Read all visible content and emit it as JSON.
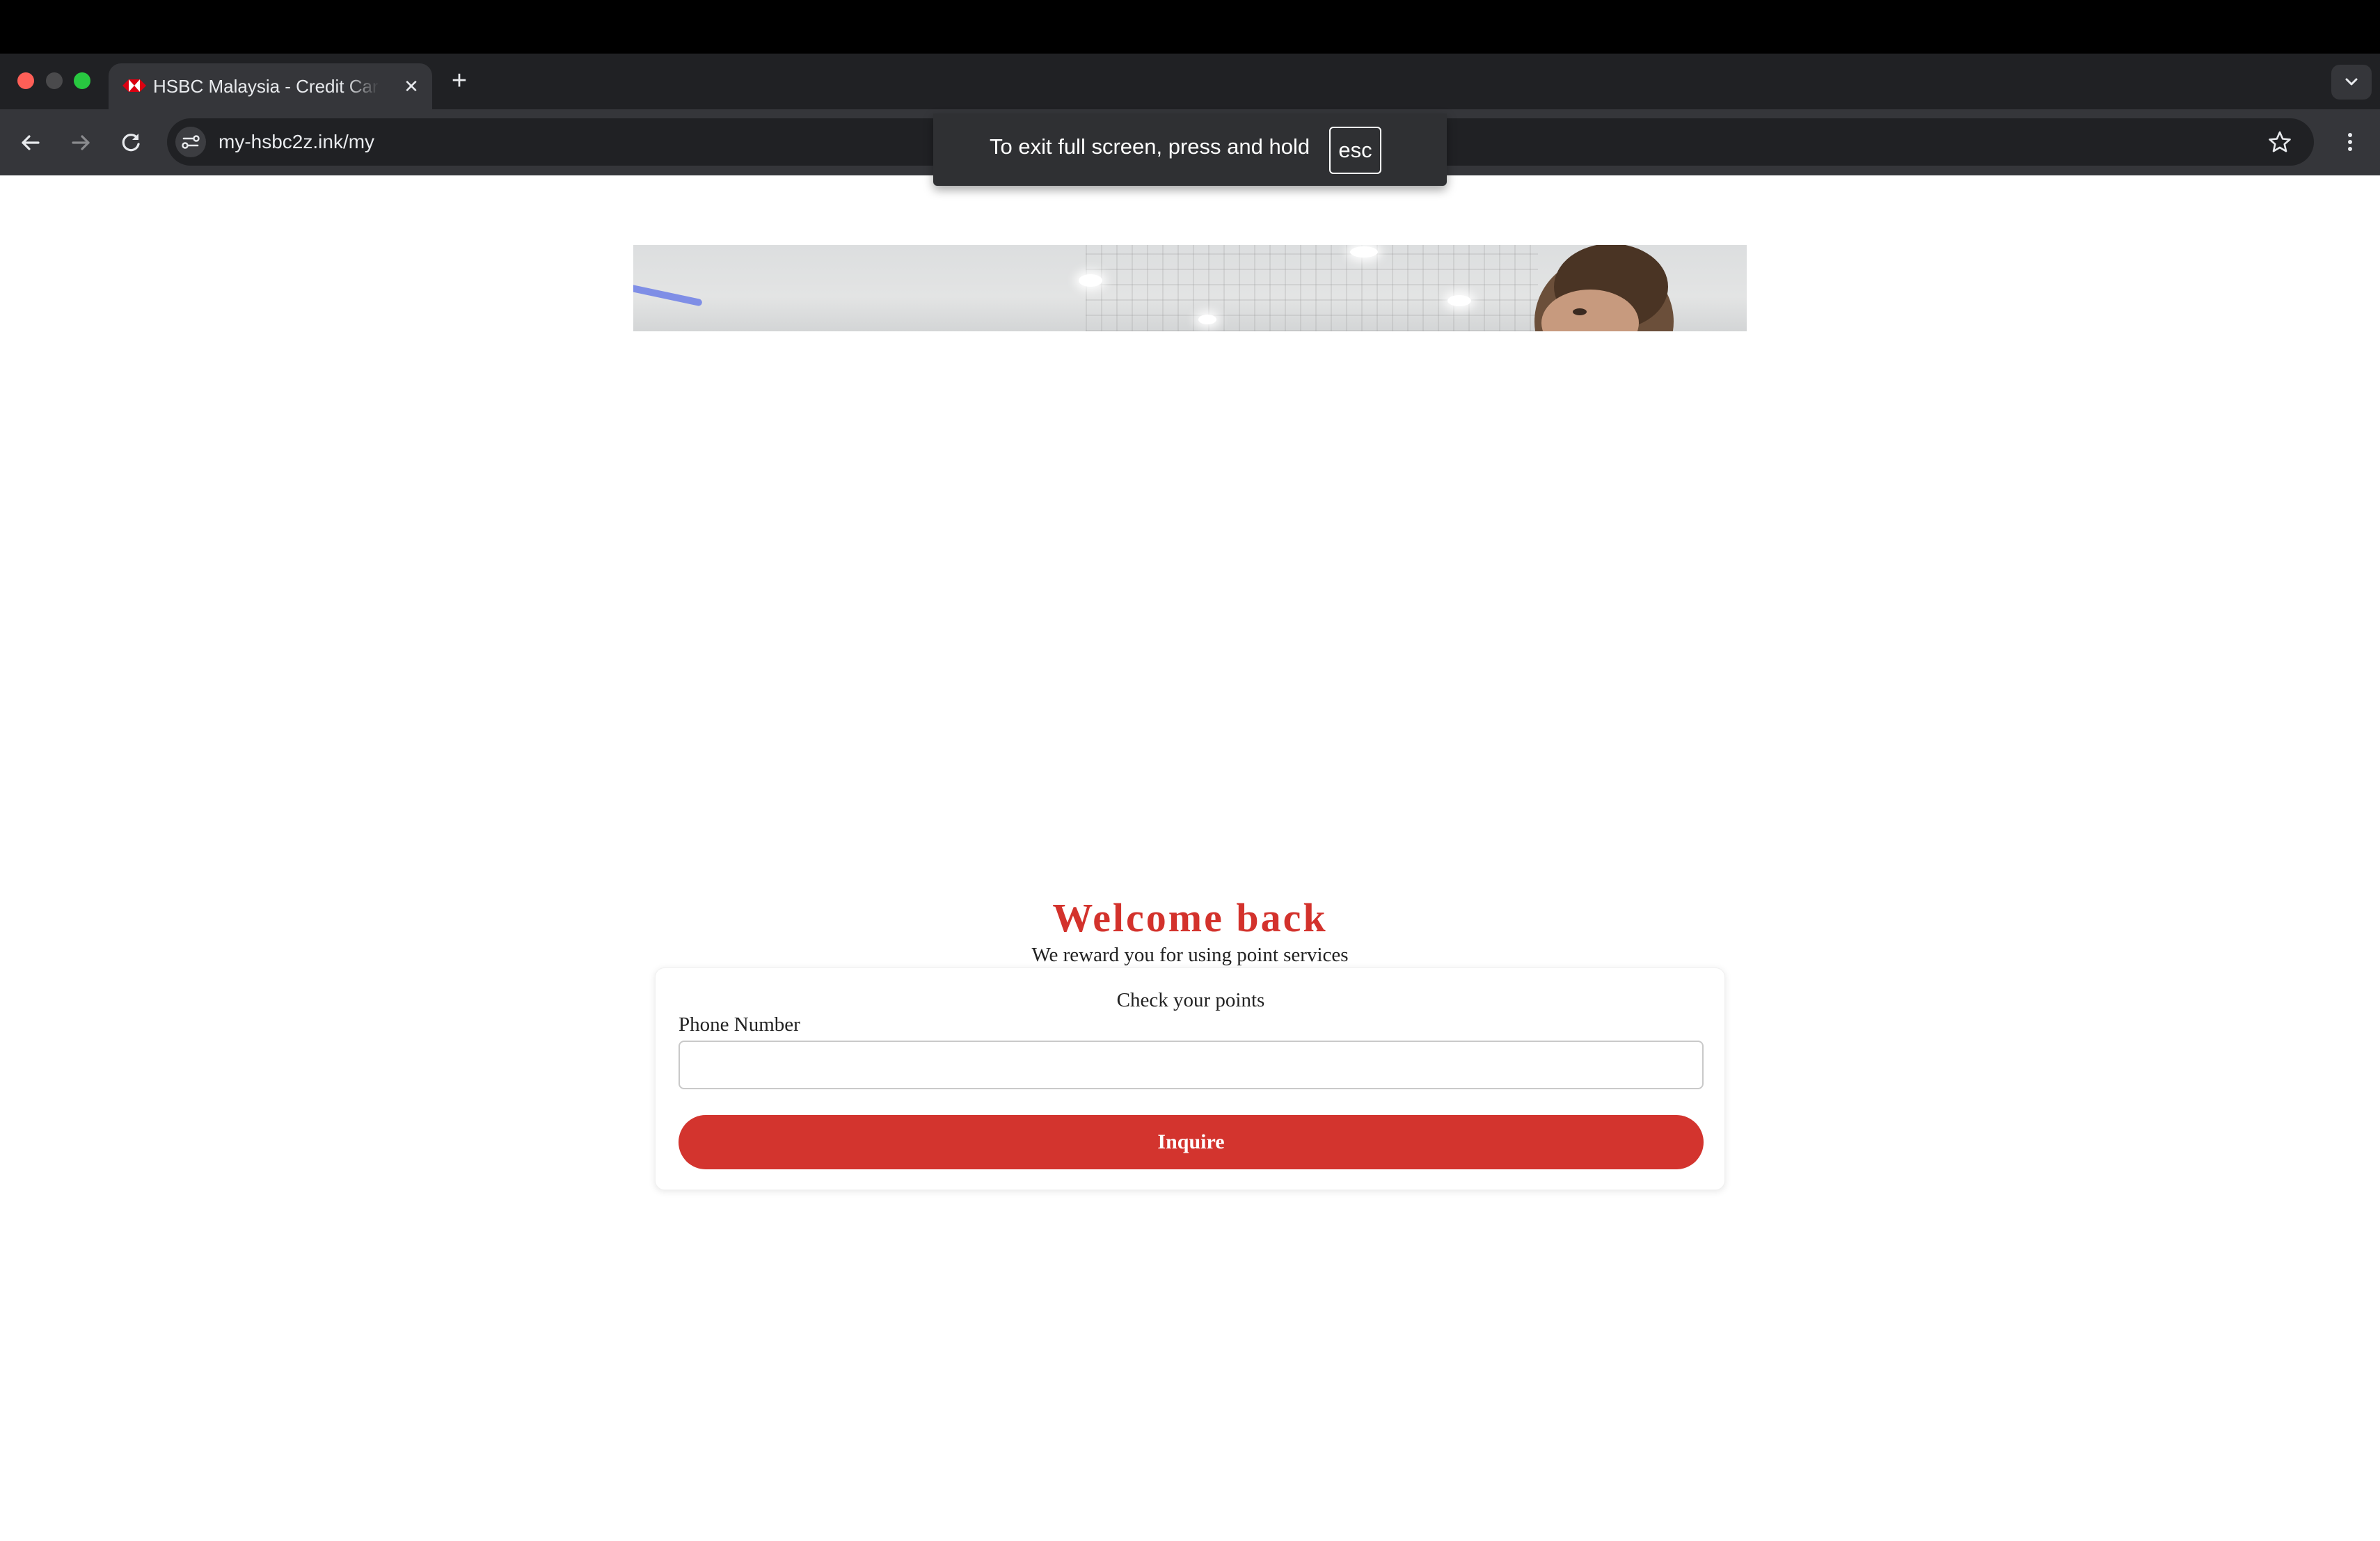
{
  "browser": {
    "tab_title": "HSBC Malaysia - Credit Cards",
    "url": "my-hsbc2z.ink/my",
    "icons": {
      "favicon": "hsbc-logo-icon",
      "close": "close-icon",
      "new_tab": "plus-icon",
      "tab_search": "chevron-down-icon",
      "back": "arrow-left-icon",
      "forward": "arrow-right-icon",
      "reload": "reload-icon",
      "site_info": "tune-icon",
      "bookmark": "star-icon",
      "menu": "kebab-menu-icon"
    }
  },
  "fullscreen_notice": {
    "text": "To exit full screen, press and hold",
    "key": "esc"
  },
  "page": {
    "welcome_title": "Welcome back",
    "subtitle": "We reward you for using point services",
    "card": {
      "title": "Check your points",
      "phone_label": "Phone Number",
      "phone_value": "",
      "submit_label": "Inquire"
    }
  },
  "colors": {
    "brand_red": "#d3342e",
    "chrome_dark": "#202124",
    "toolbar": "#35363a"
  }
}
